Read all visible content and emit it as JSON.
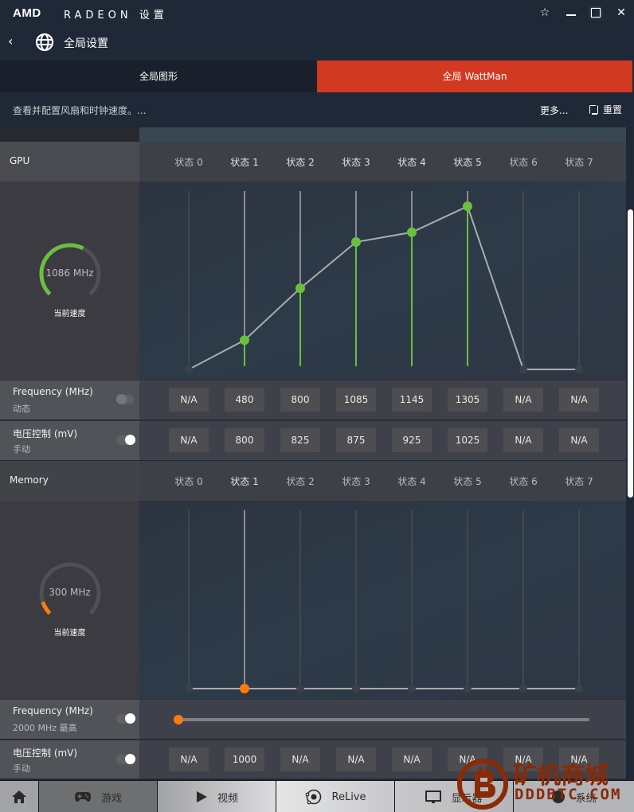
{
  "app": {
    "logo": "AMD",
    "title": "RADEON 设置",
    "window_controls": [
      "star-icon",
      "minimize-icon",
      "maximize-icon",
      "close-icon"
    ]
  },
  "nav": {
    "back_icon": "chevron-left-icon",
    "page_icon": "globe-icon",
    "title": "全局设置"
  },
  "tabs": [
    {
      "label": "全局图形",
      "active": false
    },
    {
      "label": "全局 WattMan",
      "active": true
    }
  ],
  "subbar": {
    "description": "查看并配置风扇和时钟速度。...",
    "more_label": "更多...",
    "reset_label": "重置"
  },
  "states": [
    "状态 0",
    "状态 1",
    "状态 2",
    "状态 3",
    "状态 4",
    "状态 5",
    "状态 6",
    "状态 7"
  ],
  "gpu": {
    "section_title": "GPU",
    "gauge_value": "1086 MHz",
    "gauge_caption": "当前速度",
    "gauge_fraction": 0.6,
    "frequency": {
      "label": "Frequency (MHz)",
      "mode": "动态",
      "toggle_on": false,
      "values": [
        "N/A",
        "480",
        "800",
        "1085",
        "1145",
        "1305",
        "N/A",
        "N/A"
      ]
    },
    "voltage": {
      "label": "电压控制 (mV)",
      "mode": "手动",
      "toggle_on": true,
      "values": [
        "N/A",
        "800",
        "825",
        "875",
        "925",
        "1025",
        "N/A",
        "N/A"
      ]
    }
  },
  "memory": {
    "section_title": "Memory",
    "gauge_value": "300 MHz",
    "gauge_caption": "当前速度",
    "gauge_fraction": 0.1,
    "frequency": {
      "label": "Frequency (MHz)",
      "mode": "2000 MHz 最高",
      "toggle_on": true,
      "slider_fraction": 0.0
    },
    "voltage": {
      "label": "电压控制 (mV)",
      "mode": "手动",
      "toggle_on": true,
      "values": [
        "N/A",
        "1000",
        "N/A",
        "N/A",
        "N/A",
        "N/A",
        "N/A",
        "N/A"
      ]
    }
  },
  "chart_data": [
    {
      "type": "line",
      "title": "GPU",
      "categories": [
        "状态 0",
        "状态 1",
        "状态 2",
        "状态 3",
        "状态 4",
        "状态 5",
        "状态 6",
        "状态 7"
      ],
      "series": [
        {
          "name": "Frequency (MHz)",
          "values": [
            null,
            480,
            800,
            1085,
            1145,
            1305,
            null,
            null
          ]
        }
      ],
      "active_states": [
        1,
        2,
        3,
        4,
        5
      ],
      "accent": "#6abf3f",
      "ylim": [
        300,
        1350
      ]
    },
    {
      "type": "line",
      "title": "Memory",
      "categories": [
        "状态 0",
        "状态 1",
        "状态 2",
        "状态 3",
        "状态 4",
        "状态 5",
        "状态 6",
        "状态 7"
      ],
      "series": [
        {
          "name": "Frequency (MHz)",
          "values": [
            null,
            300,
            null,
            null,
            null,
            null,
            null,
            null
          ]
        }
      ],
      "active_states": [
        1
      ],
      "accent": "#ff7a0e",
      "ylim": [
        300,
        2000
      ]
    }
  ],
  "bottom_nav": [
    {
      "label": "",
      "icon": "home-icon"
    },
    {
      "label": "游戏",
      "icon": "gamepad-icon"
    },
    {
      "label": "视频",
      "icon": "play-icon"
    },
    {
      "label": "ReLive",
      "icon": "relive-icon"
    },
    {
      "label": "显示器",
      "icon": "monitor-icon"
    },
    {
      "label": "系统",
      "icon": "system-icon"
    }
  ],
  "watermark": {
    "text": "矿机商城",
    "sub": "DDDBTC.COM"
  },
  "colors": {
    "accent_tab": "#d13a21",
    "gpu_accent": "#6abf3f",
    "memory_accent": "#ff7a0e"
  }
}
